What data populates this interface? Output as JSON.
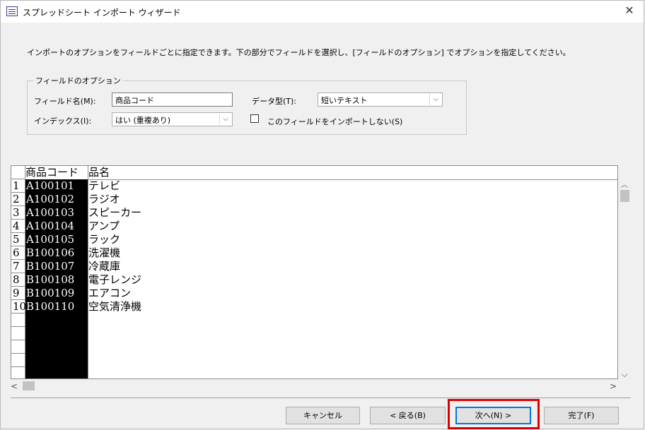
{
  "window": {
    "title": "スプレッドシート インポート ウィザード",
    "close_glyph": "✕"
  },
  "description": "インポートのオプションをフィールドごとに指定できます。下の部分でフィールドを選択し、[フィールドのオプション] でオプションを指定してください。",
  "options": {
    "group_label": "フィールドのオプション",
    "field_name_label": "フィールド名(M):",
    "field_name_value": "商品コード",
    "data_type_label": "データ型(T):",
    "data_type_value": "短いテキスト",
    "index_label": "インデックス(I):",
    "index_value": "はい (重複あり)",
    "skip_import_label": "このフィールドをインポートしない(S)"
  },
  "grid": {
    "columns": [
      "商品コード",
      "品名"
    ],
    "rows": [
      {
        "num": "1",
        "code": "A100101",
        "name": "テレビ"
      },
      {
        "num": "2",
        "code": "A100102",
        "name": "ラジオ"
      },
      {
        "num": "3",
        "code": "A100103",
        "name": "スピーカー"
      },
      {
        "num": "4",
        "code": "A100104",
        "name": "アンプ"
      },
      {
        "num": "5",
        "code": "A100105",
        "name": "ラック"
      },
      {
        "num": "6",
        "code": "B100106",
        "name": "洗濯機"
      },
      {
        "num": "7",
        "code": "B100107",
        "name": "冷蔵庫"
      },
      {
        "num": "8",
        "code": "B100108",
        "name": "電子レンジ"
      },
      {
        "num": "9",
        "code": "B100109",
        "name": "エアコン"
      },
      {
        "num": "10",
        "code": "B100110",
        "name": "空気清浄機"
      }
    ]
  },
  "buttons": {
    "cancel": "キャンセル",
    "back": "< 戻る(B)",
    "next": "次へ(N) >",
    "finish": "完了(F)"
  }
}
